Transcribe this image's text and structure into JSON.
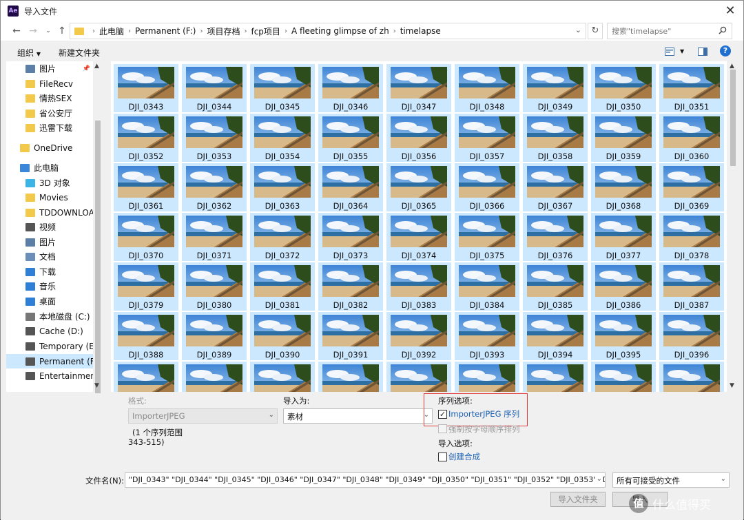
{
  "window": {
    "title": "导入文件",
    "app_icon": "Ae",
    "close_glyph": "✕"
  },
  "address": {
    "crumbs": [
      "此电脑",
      "Permanent (F:)",
      "项目存档",
      "fcp项目",
      "A fleeting glimpse of zh",
      "timelapse"
    ],
    "search_placeholder": "搜索\"timelapse\""
  },
  "toolbar": {
    "organize": "组织",
    "new_folder": "新建文件夹",
    "help": "?"
  },
  "nav": {
    "items": [
      {
        "label": "图片",
        "icon": "pictures-icon",
        "color": "#5b7fa6",
        "pinned": true
      },
      {
        "label": "FileRecv",
        "icon": "folder-icon",
        "color": "#f3c94c"
      },
      {
        "label": "情热SEX",
        "icon": "folder-icon",
        "color": "#f3c94c"
      },
      {
        "label": "省公安厅",
        "icon": "folder-icon",
        "color": "#f3c94c"
      },
      {
        "label": "迅雷下载",
        "icon": "folder-icon",
        "color": "#f3c94c"
      },
      {
        "label": "OneDrive",
        "icon": "folder-icon",
        "color": "#f3c94c"
      },
      {
        "label": "此电脑",
        "icon": "computer-icon",
        "color": "#3a86d8"
      },
      {
        "label": "3D 对象",
        "icon": "3d-objects-icon",
        "color": "#3db4e6"
      },
      {
        "label": "Movies",
        "icon": "folder-icon",
        "color": "#f3c94c"
      },
      {
        "label": "TDDOWNLOAD",
        "icon": "folder-icon",
        "color": "#f3c94c"
      },
      {
        "label": "视频",
        "icon": "videos-icon",
        "color": "#555"
      },
      {
        "label": "图片",
        "icon": "pictures-icon",
        "color": "#5b7fa6"
      },
      {
        "label": "文档",
        "icon": "documents-icon",
        "color": "#6b8fb8"
      },
      {
        "label": "下载",
        "icon": "downloads-icon",
        "color": "#2f7fd6"
      },
      {
        "label": "音乐",
        "icon": "music-icon",
        "color": "#2f7fd6"
      },
      {
        "label": "桌面",
        "icon": "desktop-icon",
        "color": "#2f7fd6"
      },
      {
        "label": "本地磁盘 (C:)",
        "icon": "drive-c-icon",
        "color": "#777"
      },
      {
        "label": "Cache (D:)",
        "icon": "drive-icon",
        "color": "#555"
      },
      {
        "label": "Temporary (E:)",
        "icon": "drive-icon",
        "color": "#555"
      },
      {
        "label": "Permanent (F:)",
        "icon": "drive-icon",
        "color": "#555",
        "selected": true
      },
      {
        "label": "Entertainment",
        "icon": "drive-icon",
        "color": "#555"
      }
    ]
  },
  "files": [
    "DJI_0343",
    "DJI_0344",
    "DJI_0345",
    "DJI_0346",
    "DJI_0347",
    "DJI_0348",
    "DJI_0349",
    "DJI_0350",
    "DJI_0351",
    "DJI_0352",
    "DJI_0353",
    "DJI_0354",
    "DJI_0355",
    "DJI_0356",
    "DJI_0357",
    "DJI_0358",
    "DJI_0359",
    "DJI_0360",
    "DJI_0361",
    "DJI_0362",
    "DJI_0363",
    "DJI_0364",
    "DJI_0365",
    "DJI_0366",
    "DJI_0367",
    "DJI_0368",
    "DJI_0369",
    "DJI_0370",
    "DJI_0371",
    "DJI_0372",
    "DJI_0373",
    "DJI_0374",
    "DJI_0375",
    "DJI_0376",
    "DJI_0377",
    "DJI_0378",
    "DJI_0379",
    "DJI_0380",
    "DJI_0381",
    "DJI_0382",
    "DJI_0383",
    "DJI_0384",
    "DJI_0385",
    "DJI_0386",
    "DJI_0387",
    "DJI_0388",
    "DJI_0389",
    "DJI_0390",
    "DJI_0391",
    "DJI_0392",
    "DJI_0393",
    "DJI_0394",
    "DJI_0395",
    "DJI_0396",
    "",
    "",
    "",
    "",
    "",
    "",
    "",
    "",
    ""
  ],
  "options": {
    "format_label": "格式:",
    "format_value": "ImporterJPEG",
    "sequence_info": "(1 个序列范围",
    "sequence_range": "343-515)",
    "import_as_label": "导入为:",
    "import_as_value": "素材",
    "seq_options_label": "序列选项:",
    "seq_checkbox_label": "ImporterJPEG 序列",
    "seq_checked": true,
    "force_alpha_label": "强制按字母顺序排列",
    "import_options_label": "导入选项:",
    "create_comp_label": "创建合成"
  },
  "footer": {
    "filename_label": "文件名(N):",
    "filename_value": "\"DJI_0343\" \"DJI_0344\" \"DJI_0345\" \"DJI_0346\" \"DJI_0347\" \"DJI_0348\" \"DJI_0349\" \"DJI_0350\" \"DJI_0351\" \"DJI_0352\" \"DJI_0353\" \"DJI_0",
    "filetype_value": "所有可接受的文件",
    "import_folder_button": "导入文件夹",
    "import_button": "导入"
  },
  "watermark": {
    "glyph": "值",
    "text": "什么值得买"
  }
}
